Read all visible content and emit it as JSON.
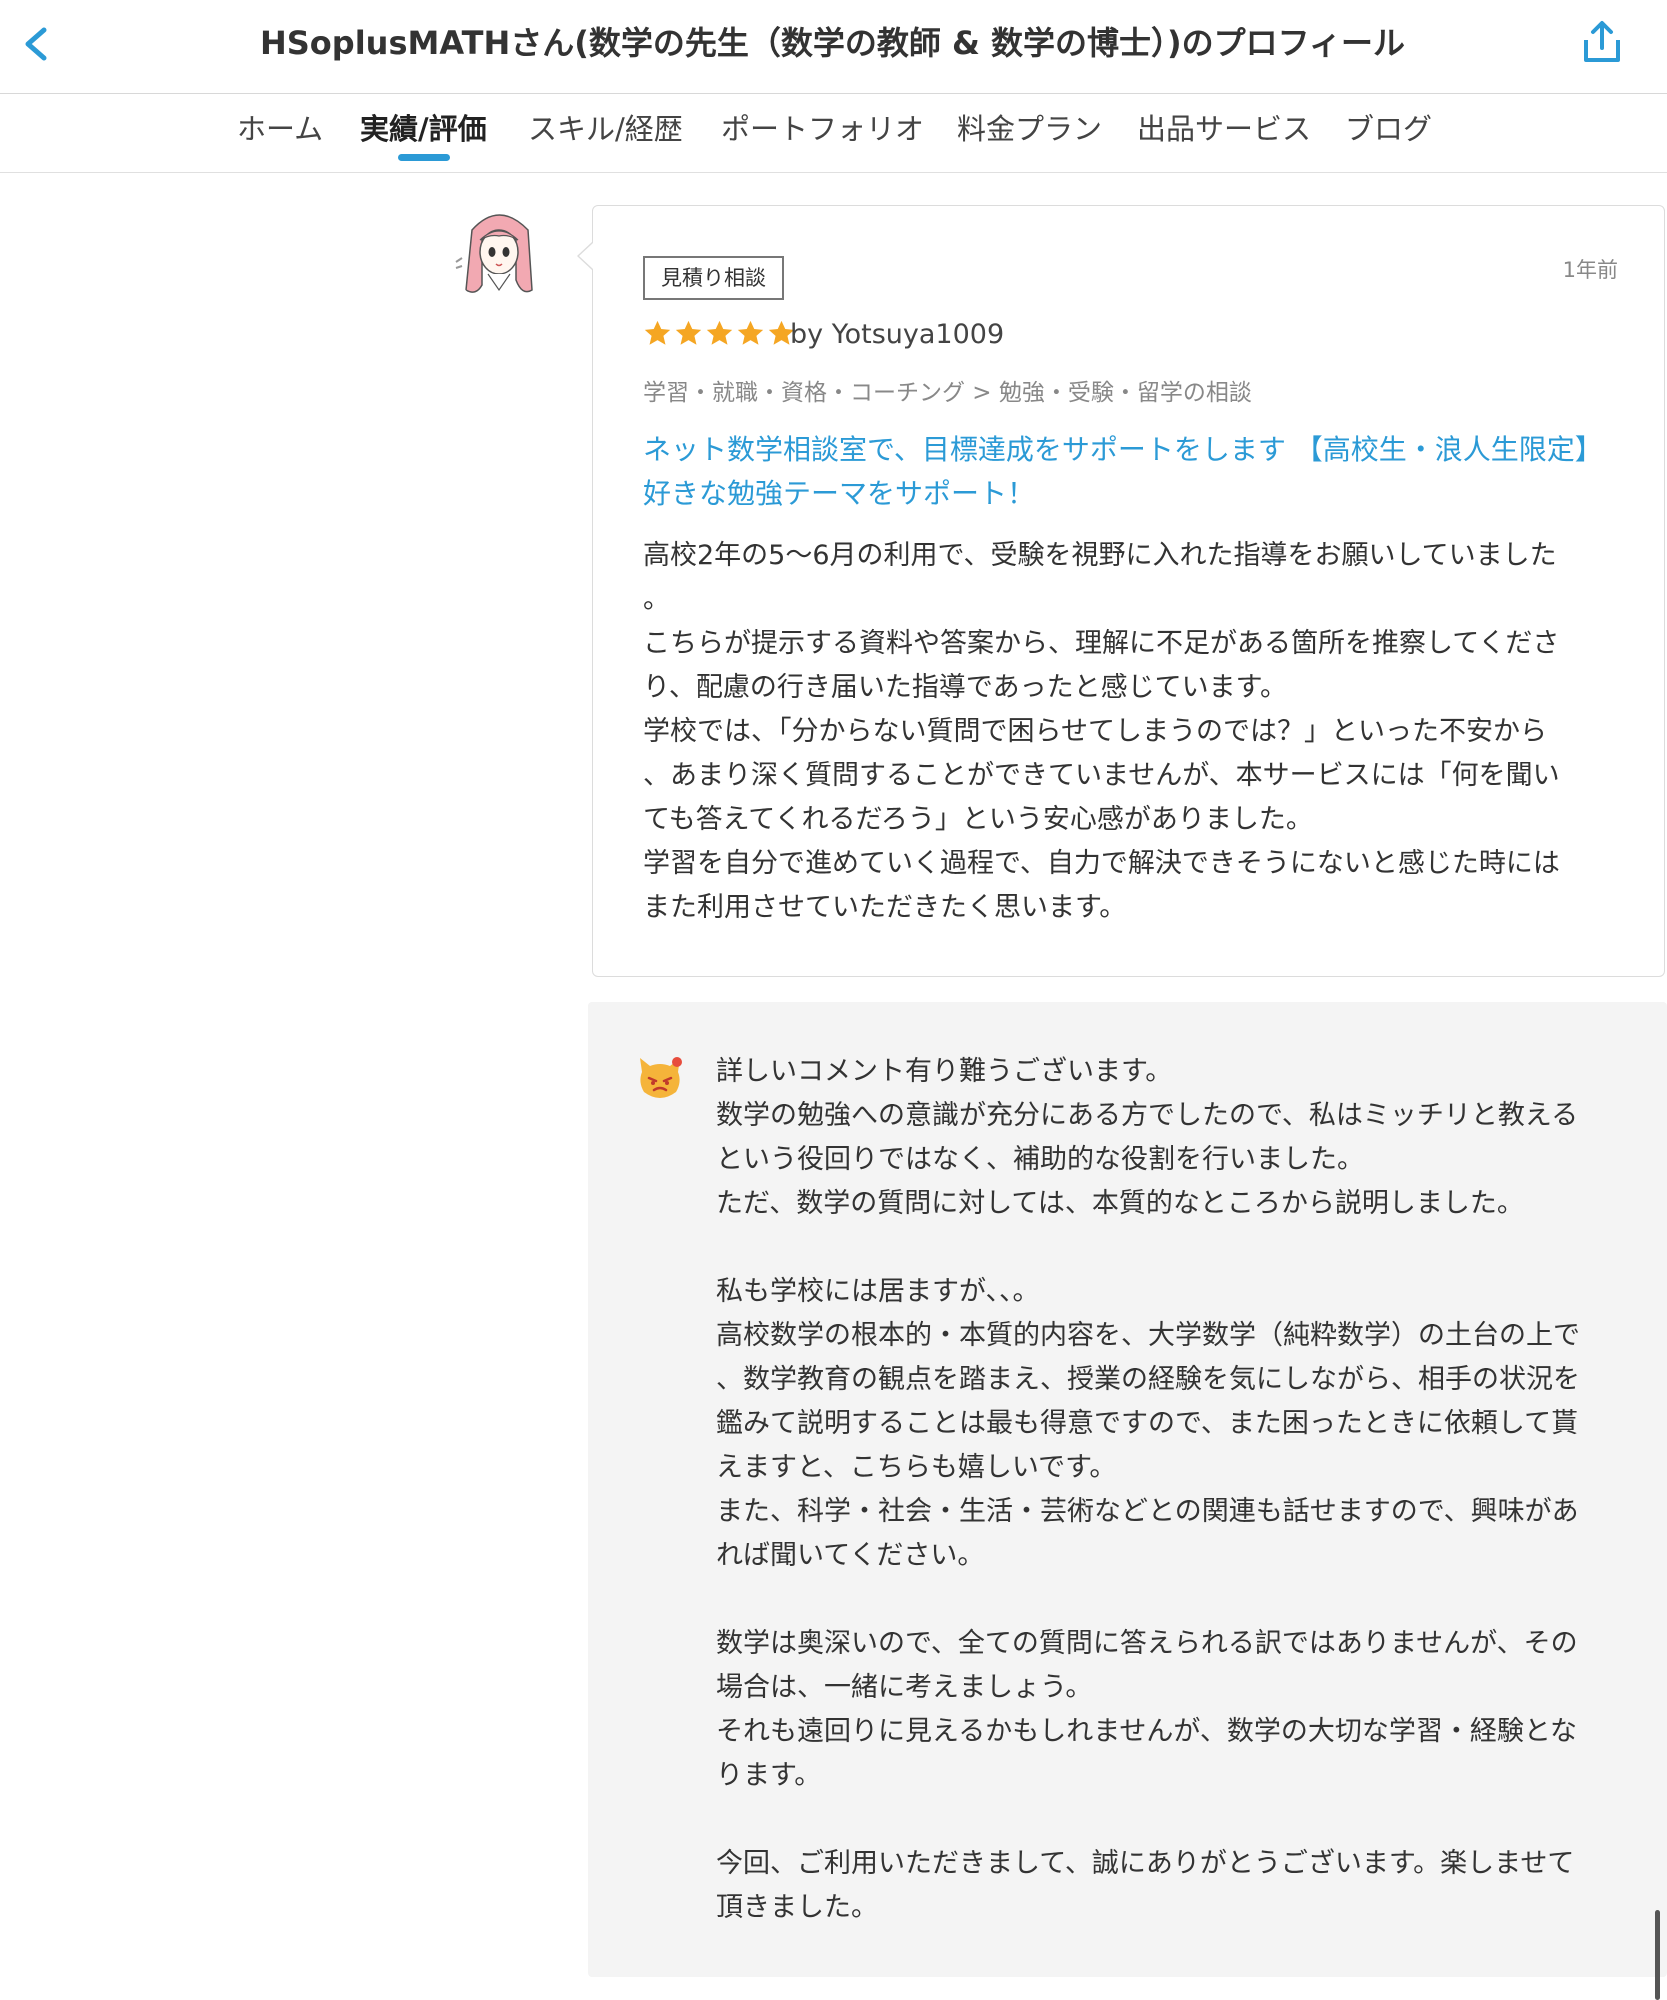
{
  "header": {
    "title": "HSoplusMATHさん(数学の先生（数学の教師 & 数学の博士）)のプロフィール",
    "back_icon": "chevron-left-icon",
    "share_icon": "share-icon"
  },
  "tabs": [
    {
      "label": "ホーム"
    },
    {
      "label": "実績/評価"
    },
    {
      "label": "スキル/経歴"
    },
    {
      "label": "ポートフォリオ"
    },
    {
      "label": "料金プラン"
    },
    {
      "label": "出品サービス"
    },
    {
      "label": "ブログ"
    }
  ],
  "active_tab": "実績/評価",
  "review": {
    "badge": "見積り相談",
    "time_ago": "1年前",
    "rating": 5,
    "reviewer": "by Yotsuya1009",
    "category": "学習・就職・資格・コーチング > 勉強・受験・留学の相談",
    "service_title_lines": [
      "ネット数学相談室で、目標達成をサポートをします 【高校生・浪人生限定】",
      "好きな勉強テーマをサポート！"
    ],
    "body_lines": [
      "高校2年の5〜6月の利用で、受験を視野に入れた指導をお願いしていました",
      "。",
      "こちらが提示する資料や答案から、理解に不足がある箇所を推察してくださ",
      "り、配慮の行き届いた指導であったと感じています。",
      "学校では、「分からない質問で困らせてしまうのでは？」といった不安から",
      "、あまり深く質問することができていませんが、本サービスには「何を聞い",
      "ても答えてくれるだろう」という安心感がありました。",
      "学習を自分で進めていく過程で、自力で解決できそうにないと感じた時には",
      "また利用させていただきたく思います。"
    ]
  },
  "reply": {
    "icon": "seller-reply-icon",
    "body_lines": [
      "詳しいコメント有り難うございます。",
      "数学の勉強への意識が充分にある方でしたので、私はミッチリと教える",
      "という役回りではなく、補助的な役割を行いました。",
      "ただ、数学の質問に対しては、本質的なところから説明しました。",
      "",
      "私も学校には居ますが、、。",
      "高校数学の根本的・本質的内容を、大学数学（純粋数学）の土台の上で",
      "、数学教育の観点を踏まえ、授業の経験を気にしながら、相手の状況を",
      "鑑みて説明することは最も得意ですので、また困ったときに依頼して貰",
      "えますと、こちらも嬉しいです。",
      "また、科学・社会・生活・芸術などとの関連も話せますので、興味があ",
      "れば聞いてください。",
      "",
      "数学は奥深いので、全ての質問に答えられる訳ではありませんが、その",
      "場合は、一緒に考えましょう。",
      "それも遠回りに見えるかもしれませんが、数学の大切な学習・経験とな",
      "ります。",
      "",
      "今回、ご利用いただきまして、誠にありがとうございます。楽しませて",
      "頂きました。"
    ]
  },
  "colors": {
    "accent": "#2b9ad6",
    "star": "#f5a623",
    "reply_bg": "#f4f4f4"
  }
}
